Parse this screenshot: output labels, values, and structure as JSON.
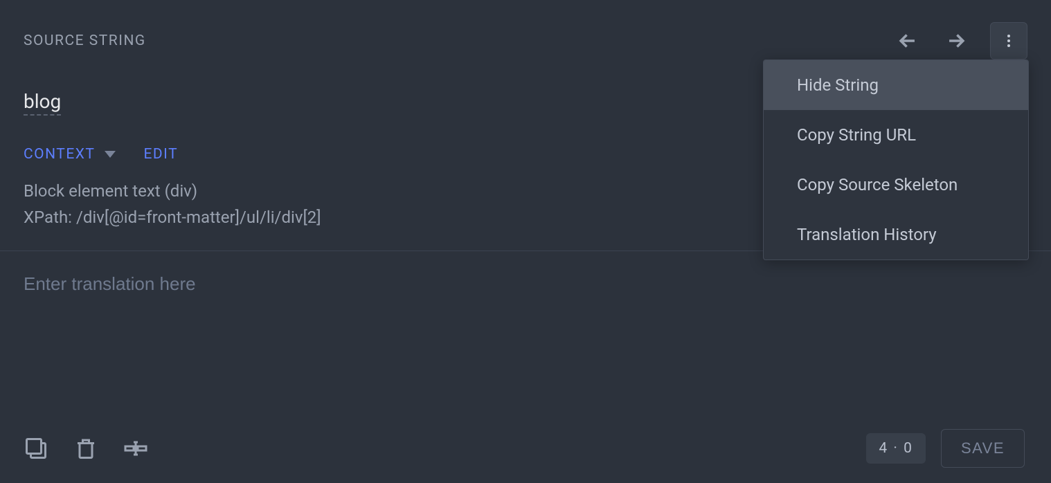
{
  "header": {
    "title": "SOURCE STRING"
  },
  "source": {
    "value": "blog"
  },
  "context": {
    "label": "CONTEXT",
    "edit": "EDIT",
    "line1": "Block element text (div)",
    "line2": "XPath: /div[@id=front-matter]/ul/li/div[2]"
  },
  "translation": {
    "placeholder": "Enter translation here"
  },
  "footer": {
    "count": "4 · 0",
    "save": "SAVE"
  },
  "menu": {
    "items": [
      "Hide String",
      "Copy String URL",
      "Copy Source Skeleton",
      "Translation History"
    ]
  }
}
